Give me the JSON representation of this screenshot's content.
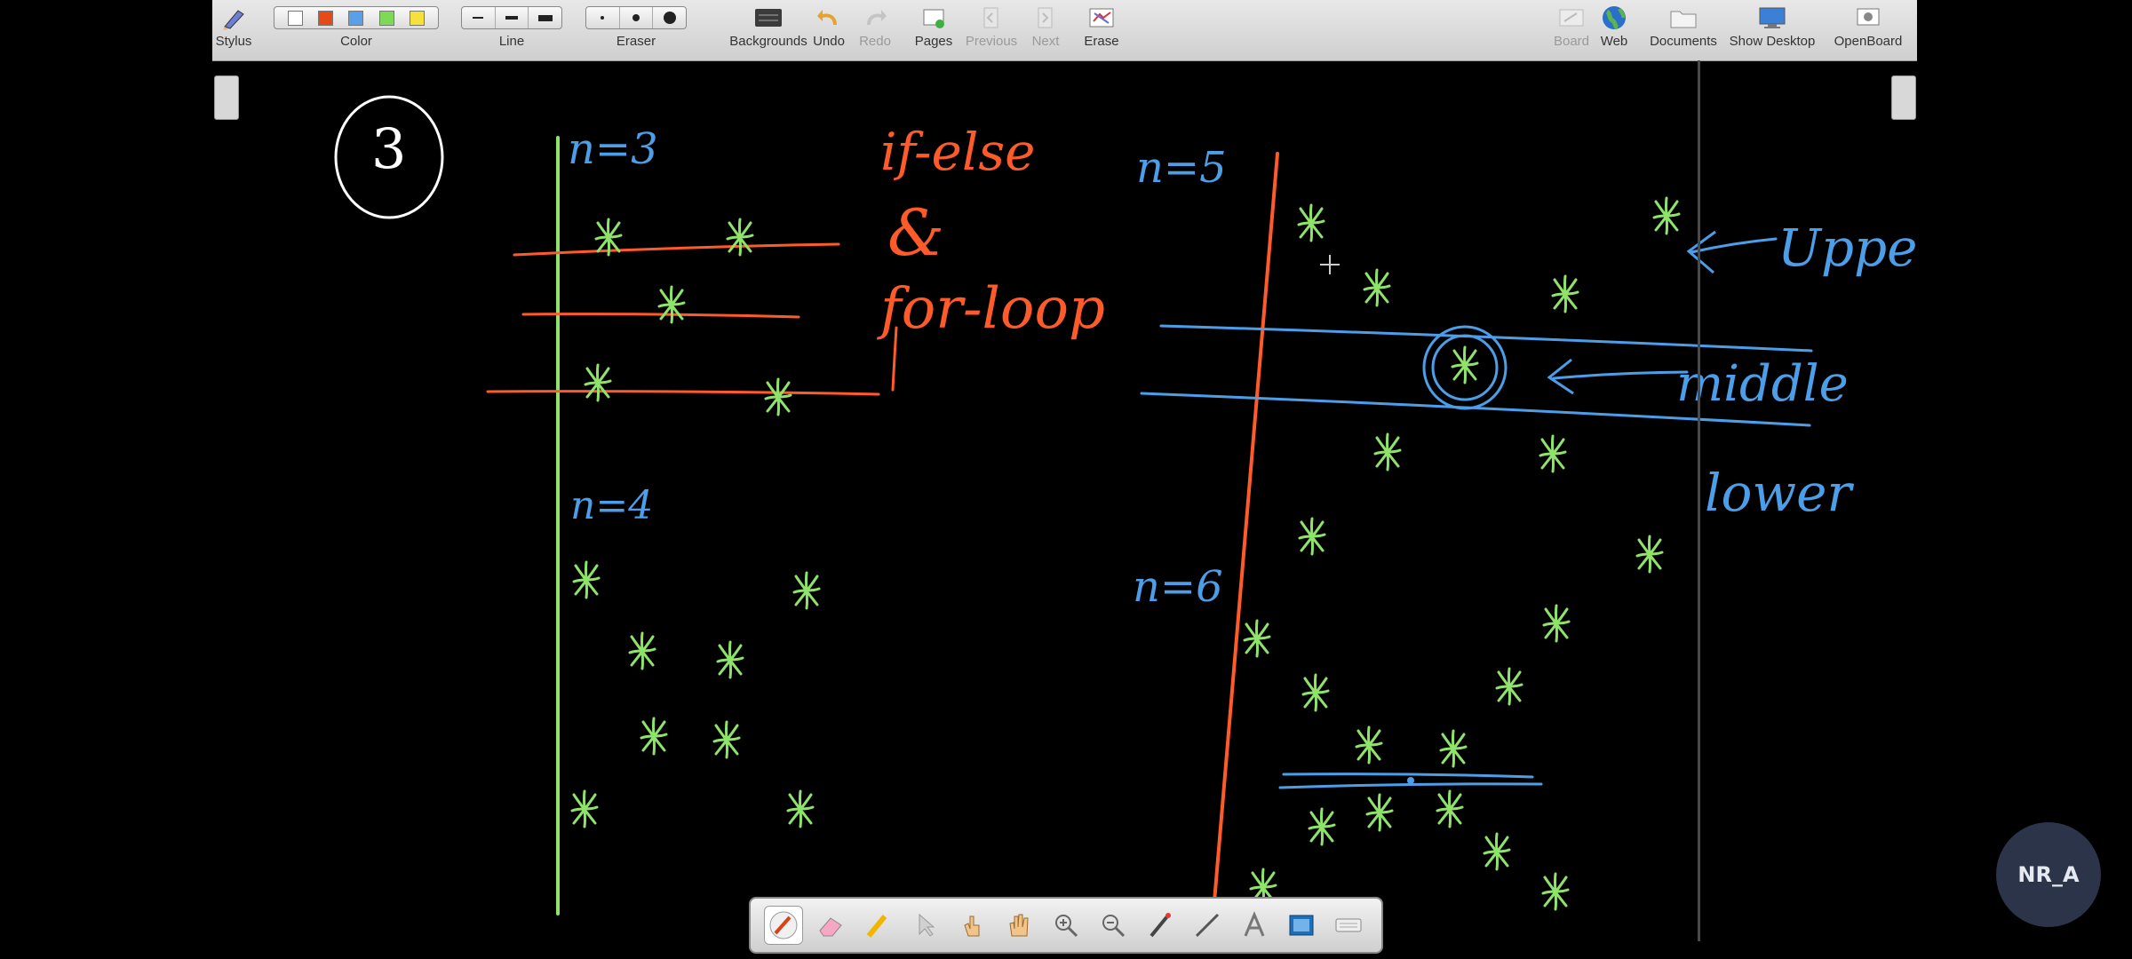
{
  "toolbar": {
    "stylus": "Stylus",
    "color": "Color",
    "line": "Line",
    "eraser": "Eraser",
    "backgrounds": "Backgrounds",
    "undo": "Undo",
    "redo": "Redo",
    "pages": "Pages",
    "previous": "Previous",
    "next": "Next",
    "erase": "Erase",
    "board": "Board",
    "web": "Web",
    "documents": "Documents",
    "show_desktop": "Show Desktop",
    "openboard": "OpenBoard",
    "swatches": [
      "#ffffff",
      "#e64a19",
      "#5aa0e8",
      "#7ed957",
      "#f5e03c"
    ]
  },
  "board": {
    "circled_number": "3",
    "left_n3": "n=3",
    "left_n4": "n=4",
    "right_n5": "n=5",
    "right_n6": "n=6",
    "note_ifelse": "if-else",
    "note_amp": "&",
    "note_forloop": "for-loop",
    "note_upper": "Upper",
    "note_middle": "middle",
    "note_lower": "lower",
    "colors": {
      "green": "#8fe36b",
      "orange": "#ff5a2a",
      "blue": "#4d9ee8",
      "white": "#ffffff"
    }
  },
  "palette": {
    "tools": [
      "pen-icon",
      "eraser-icon",
      "marker-icon",
      "selector-icon",
      "interactor-icon",
      "hand-icon",
      "zoom-in-icon",
      "zoom-out-icon",
      "laser-pointer-icon",
      "line-icon",
      "text-icon",
      "capture-icon",
      "virtual-keyboard-icon"
    ]
  },
  "watermark": "NR_A"
}
